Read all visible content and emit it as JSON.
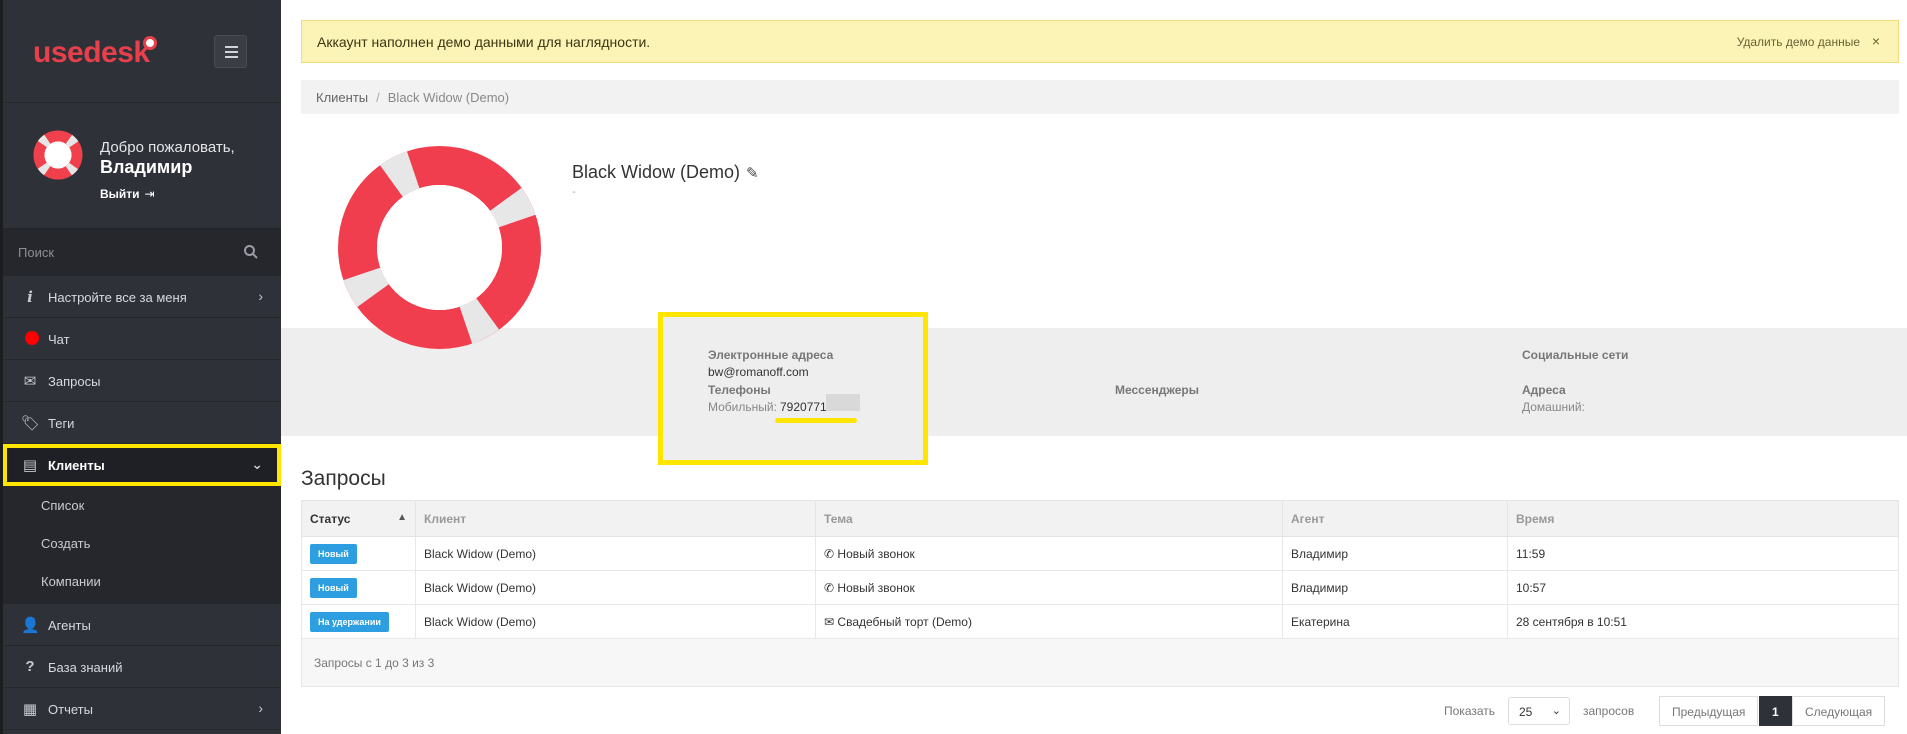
{
  "sidebar": {
    "logo": "usedesk",
    "welcome": "Добро пожаловать,",
    "username": "Владимир",
    "logout": "Выйти",
    "search_placeholder": "Поиск",
    "items": [
      {
        "label": "Настройте все за меня",
        "icon": "info-icon"
      },
      {
        "label": "Чат",
        "icon": "status-dot-icon"
      },
      {
        "label": "Запросы",
        "icon": "envelope-icon"
      },
      {
        "label": "Теги",
        "icon": "tag-icon"
      },
      {
        "label": "Клиенты",
        "icon": "contact-card-icon"
      },
      {
        "label": "Агенты",
        "icon": "user-icon"
      },
      {
        "label": "База знаний",
        "icon": "question-icon"
      },
      {
        "label": "Отчеты",
        "icon": "report-icon"
      }
    ],
    "subitems": [
      "Список",
      "Создать",
      "Компании"
    ]
  },
  "alert": {
    "text": "Аккаунт наполнен демо данными для наглядности.",
    "action": "Удалить демо данные",
    "close": "×"
  },
  "breadcrumb": {
    "root": "Клиенты",
    "current": "Black Widow (Demo)"
  },
  "client": {
    "name": "Black Widow (Demo)",
    "subtitle": "-",
    "emails_label": "Электронные адреса",
    "email": "bw@romanoff.com",
    "phones_label": "Телефоны",
    "mobile_label": "Мобильный:",
    "mobile_value": "7920771",
    "messengers_label": "Мессенджеры",
    "social_label": "Социальные сети",
    "addresses_label": "Адреса",
    "home_label": "Домашний:"
  },
  "requests": {
    "title": "Запросы",
    "columns": [
      "Статус",
      "Клиент",
      "Тема",
      "Агент",
      "Время"
    ],
    "rows": [
      {
        "status": "Новый",
        "client": "Black Widow (Demo)",
        "topic": "Новый звонок",
        "topic_icon": "phone-icon",
        "agent": "Владимир",
        "time": "11:59"
      },
      {
        "status": "Новый",
        "client": "Black Widow (Demo)",
        "topic": "Новый звонок",
        "topic_icon": "phone-icon",
        "agent": "Владимир",
        "time": "10:57"
      },
      {
        "status": "На удержании",
        "client": "Black Widow (Demo)",
        "topic": "Свадебный торт (Demo)",
        "topic_icon": "envelope-icon",
        "agent": "Екатерина",
        "time": "28 сентября в 10:51"
      }
    ],
    "summary": "Запросы с 1 до 3 из 3"
  },
  "pagination": {
    "show_label": "Показать",
    "per_page": "25",
    "requests_label": "запросов",
    "prev": "Предыдущая",
    "current": "1",
    "next": "Следующая"
  },
  "colors": {
    "brand": "#e8404a",
    "highlight": "#ffe500",
    "badge": "#2d9ee0",
    "sidebar": "#2f3139"
  }
}
